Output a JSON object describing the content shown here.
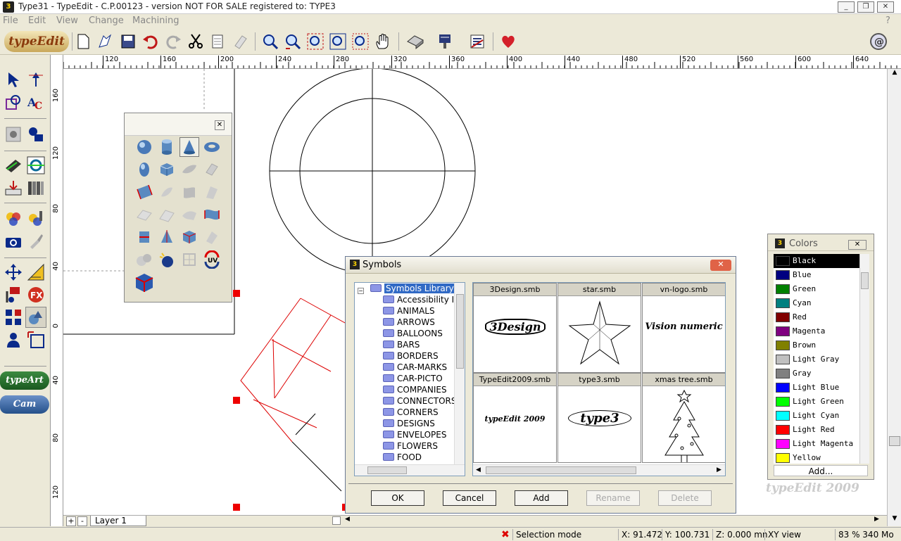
{
  "window": {
    "title": "Type31 - TypeEdit - C.P.00123 - version NOT FOR SALE registered to: TYPE3"
  },
  "menu": [
    "File",
    "Edit",
    "View",
    "Change",
    "Machining"
  ],
  "menu_help": "?",
  "toolbar": {
    "logo": "typeEdit"
  },
  "rulers": {
    "h_labels": [
      "120",
      "160",
      "200",
      "240",
      "280",
      "320",
      "360",
      "400",
      "440",
      "480",
      "520",
      "560",
      "600",
      "640"
    ],
    "v_labels": [
      "160",
      "120",
      "80",
      "40",
      "0",
      "40",
      "80",
      "120"
    ]
  },
  "left_tools": {
    "type_art": "typeArt",
    "cam": "Cam"
  },
  "layer": {
    "label": "Layer 1",
    "plus": "+",
    "minus": "-"
  },
  "symbols_dialog": {
    "title": "Symbols",
    "close": "✕",
    "tree_root": "Symbols Library",
    "tree_items": [
      "Accessibility Info",
      "ANIMALS",
      "ARROWS",
      "BALLOONS",
      "BARS",
      "BORDERS",
      "CAR-MARKS",
      "CAR-PICTO",
      "COMPANIES",
      "CONNECTORS",
      "CORNERS",
      "DESIGNS",
      "ENVELOPES",
      "FLOWERS",
      "FOOD"
    ],
    "files": [
      {
        "name": "3Design.smb",
        "preview": "3Design"
      },
      {
        "name": "star.smb",
        "preview": ""
      },
      {
        "name": "vn-logo.smb",
        "preview": "Vision numeric"
      },
      {
        "name": "TypeEdit2009.smb",
        "preview": "typeEdit 2009"
      },
      {
        "name": "type3.smb",
        "preview": "type3"
      },
      {
        "name": "xmas tree.smb",
        "preview": ""
      }
    ],
    "buttons": {
      "ok": "OK",
      "cancel": "Cancel",
      "add": "Add",
      "rename": "Rename",
      "delete": "Delete"
    }
  },
  "colors_panel": {
    "title": "Colors",
    "close": "✕",
    "items": [
      {
        "name": "Black",
        "hex": "#000000"
      },
      {
        "name": "Blue",
        "hex": "#000080"
      },
      {
        "name": "Green",
        "hex": "#008000"
      },
      {
        "name": "Cyan",
        "hex": "#008080"
      },
      {
        "name": "Red",
        "hex": "#800000"
      },
      {
        "name": "Magenta",
        "hex": "#800080"
      },
      {
        "name": "Brown",
        "hex": "#808000"
      },
      {
        "name": "Light Gray",
        "hex": "#c0c0c0"
      },
      {
        "name": "Gray",
        "hex": "#808080"
      },
      {
        "name": "Light Blue",
        "hex": "#0000ff"
      },
      {
        "name": "Light Green",
        "hex": "#00ff00"
      },
      {
        "name": "Light Cyan",
        "hex": "#00ffff"
      },
      {
        "name": "Light Red",
        "hex": "#ff0000"
      },
      {
        "name": "Light Magenta",
        "hex": "#ff00ff"
      },
      {
        "name": "Yellow",
        "hex": "#ffff00"
      }
    ],
    "add": "Add..."
  },
  "watermark": "typeEdit 2009",
  "status": {
    "mode": "Selection mode",
    "x": "X: 91.472",
    "y": "Y: 100.731",
    "z": "Z: 0.000 mn",
    "view": "XY view",
    "zoom": "83 % 340 Mo"
  }
}
